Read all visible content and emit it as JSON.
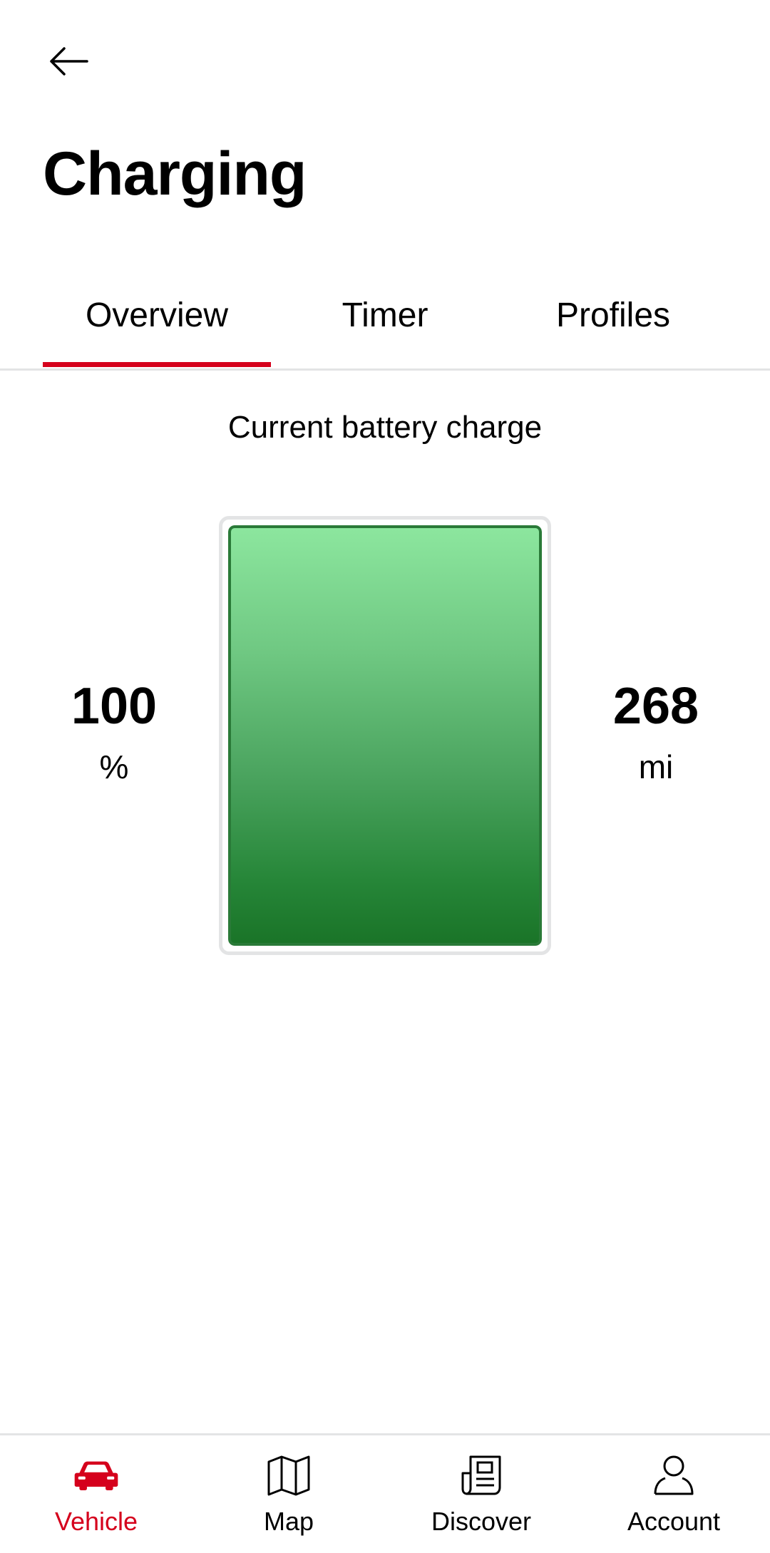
{
  "header": {
    "back_icon": "arrow-left-icon",
    "title": "Charging"
  },
  "tabs": [
    {
      "label": "Overview",
      "active": true
    },
    {
      "label": "Timer",
      "active": false
    },
    {
      "label": "Profiles",
      "active": false
    }
  ],
  "battery": {
    "section_title": "Current battery charge",
    "charge_value": "100",
    "charge_unit": "%",
    "charge_level": 1.0,
    "range_value": "268",
    "range_unit": "mi",
    "fill_color": "#268638"
  },
  "bottom_nav": [
    {
      "label": "Vehicle",
      "icon": "car-icon",
      "active": true
    },
    {
      "label": "Map",
      "icon": "map-icon",
      "active": false
    },
    {
      "label": "Discover",
      "icon": "newspaper-icon",
      "active": false
    },
    {
      "label": "Account",
      "icon": "user-icon",
      "active": false
    }
  ],
  "colors": {
    "accent": "#d5001c",
    "divider": "#e3e4e5"
  }
}
